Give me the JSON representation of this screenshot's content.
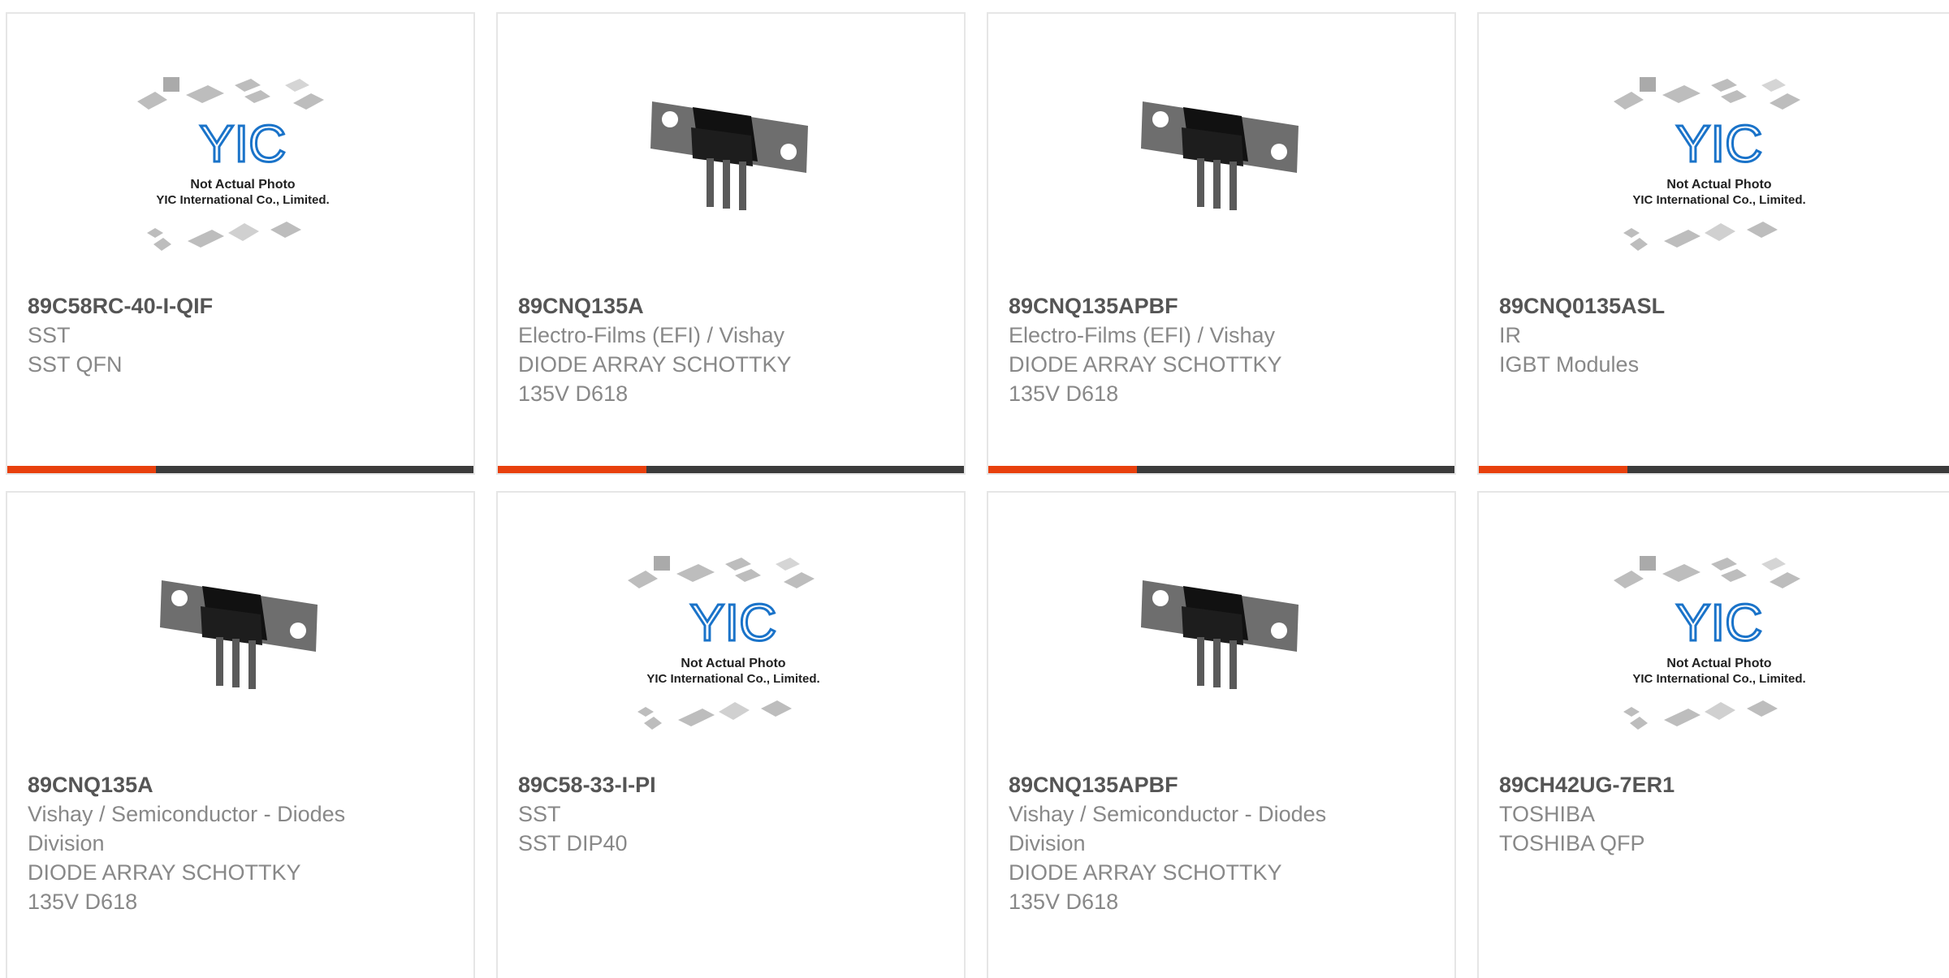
{
  "products": [
    {
      "part": "89C58RC-40-I-QIF",
      "lines": [
        "SST",
        "SST QFN"
      ],
      "image": "yic-placeholder",
      "placeholder": {
        "line1": "Not Actual Photo",
        "line2": "YIC International Co., Limited.",
        "logo": "YIC"
      }
    },
    {
      "part": "89CNQ135A",
      "lines": [
        "Electro-Films (EFI) / Vishay",
        "DIODE ARRAY SCHOTTKY",
        "135V D618"
      ],
      "image": "d618-diode"
    },
    {
      "part": "89CNQ135APBF",
      "lines": [
        "Electro-Films (EFI) / Vishay",
        "DIODE ARRAY SCHOTTKY",
        "135V D618"
      ],
      "image": "d618-diode"
    },
    {
      "part": "89CNQ0135ASL",
      "lines": [
        "IR",
        "IGBT Modules"
      ],
      "image": "yic-placeholder",
      "placeholder": {
        "line1": "Not Actual Photo",
        "line2": "YIC International Co., Limited.",
        "logo": "YIC"
      }
    },
    {
      "part": "89CNQ135A",
      "lines": [
        "Vishay / Semiconductor - Diodes",
        "Division",
        "DIODE ARRAY SCHOTTKY",
        "135V D618"
      ],
      "image": "d618-diode"
    },
    {
      "part": "89C58-33-I-PI",
      "lines": [
        "SST",
        "SST DIP40"
      ],
      "image": "yic-placeholder",
      "placeholder": {
        "line1": "Not Actual Photo",
        "line2": "YIC International Co., Limited.",
        "logo": "YIC"
      }
    },
    {
      "part": "89CNQ135APBF",
      "lines": [
        "Vishay / Semiconductor - Diodes",
        "Division",
        "DIODE ARRAY SCHOTTKY",
        "135V D618"
      ],
      "image": "d618-diode"
    },
    {
      "part": "89CH42UG-7ER1",
      "lines": [
        "TOSHIBA",
        "TOSHIBA QFP"
      ],
      "image": "yic-placeholder",
      "placeholder": {
        "line1": "Not Actual Photo",
        "line2": "YIC International Co., Limited.",
        "logo": "YIC"
      }
    }
  ],
  "colors": {
    "accent": "#e8400d",
    "bar": "#3b3b3b",
    "part_text": "#555555",
    "desc_text": "#888888",
    "logo_blue": "#1a73c9"
  }
}
